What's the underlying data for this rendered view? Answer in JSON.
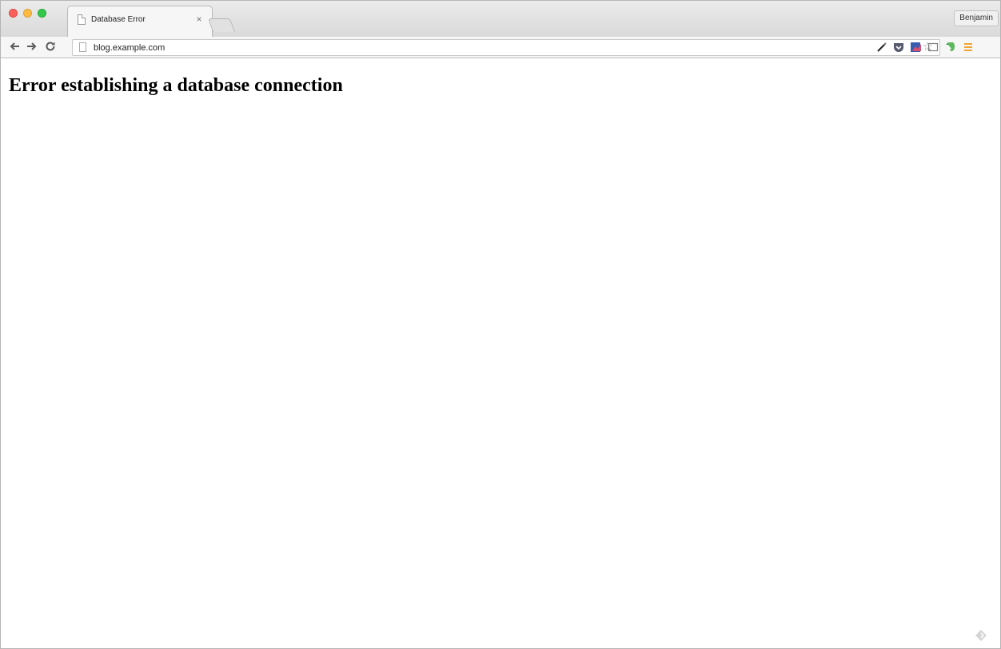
{
  "window": {
    "traffic_lights": [
      "close",
      "minimize",
      "maximize"
    ]
  },
  "tab": {
    "title": "Database Error",
    "close_label": "×",
    "icon": "page-icon"
  },
  "profile": {
    "name": "Benjamin"
  },
  "toolbar": {
    "back_icon": "back-arrow-icon",
    "forward_icon": "forward-arrow-icon",
    "reload_icon": "reload-icon",
    "url": "blog.example.com",
    "bookmark_icon": "star-icon",
    "extensions": [
      "pen-icon",
      "pocket-icon",
      "lens-icon",
      "cast-icon",
      "evernote-icon",
      "menu-icon"
    ]
  },
  "page": {
    "heading": "Error establishing a database connection"
  },
  "colors": {
    "menu_accent": "#f0a431",
    "evernote_green": "#5cb85c",
    "pocket_red": "#555a6d"
  }
}
